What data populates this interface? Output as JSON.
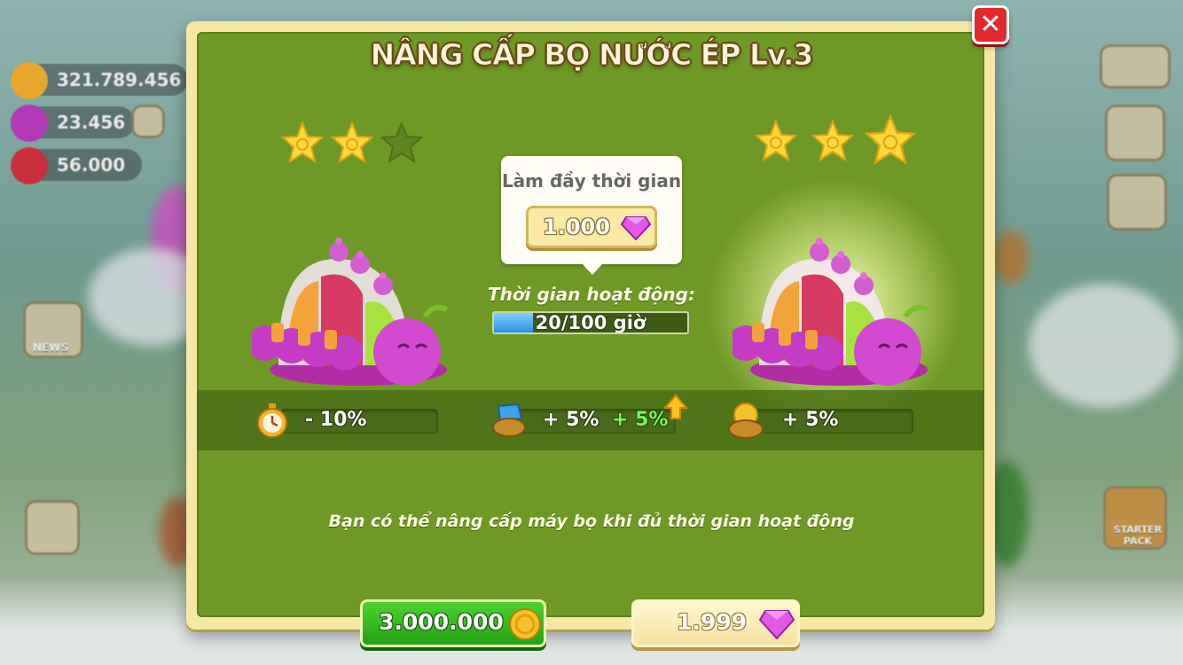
{
  "hud": {
    "coins": "321.789.456",
    "gems": "23.456",
    "hearts": "56.000"
  },
  "side": {
    "news_label": "NEWS",
    "starter_pack_label": "STARTER PACK"
  },
  "dialog": {
    "title": "NÂNG CẤP BỌ NƯỚC ÉP Lv.3",
    "current_stars": 2,
    "next_stars": 3,
    "max_stars": 3,
    "tooltip": {
      "title": "Làm đầy thời gian",
      "cost": "1.000"
    },
    "operation_label": "Thời gian hoạt động:",
    "operation_progress": "20/100 giờ",
    "operation_fraction": 0.2,
    "stats": {
      "time_bonus": "- 10%",
      "juice_bonus": "+ 5%",
      "juice_bonus_next": "+ 5%",
      "coin_bonus": "+ 5%"
    },
    "hint": "Bạn có thể nâng cấp máy bọ khi đủ thời gian hoạt động",
    "upgrade_coin_price": "3.000.000",
    "upgrade_gem_price": "1.999"
  },
  "icons": {
    "close": "close-icon",
    "coin": "coin-icon",
    "gem": "gem-icon",
    "stopwatch": "stopwatch-icon",
    "juice_basket": "juice-basket-icon",
    "coin_basket": "coin-basket-icon",
    "arrow_up": "arrow-up-icon"
  },
  "colors": {
    "panel_green": "#6f9926",
    "frame": "#f7e7a6",
    "close_red": "#e32a2a",
    "coin_button": "#22a112",
    "progress_blue": "#2e8ee6",
    "bonus_green": "#6dff4a"
  }
}
